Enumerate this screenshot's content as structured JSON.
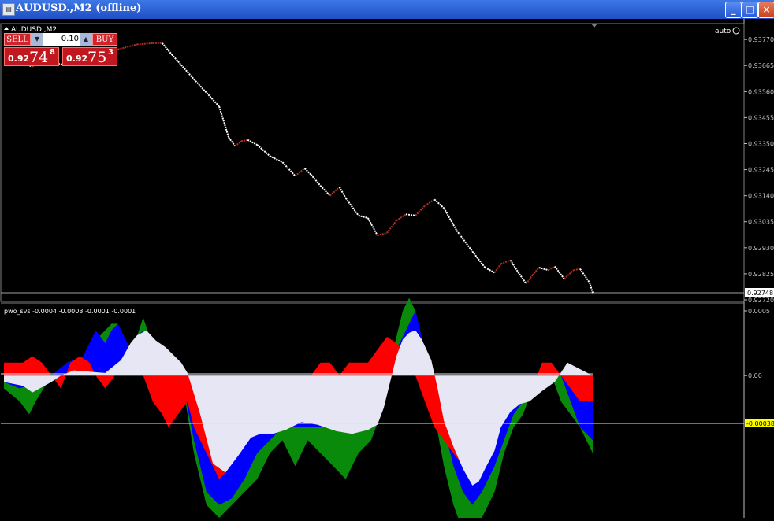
{
  "window": {
    "title": "AUDUSD.,M2 (offline)",
    "buttons": {
      "minimize": "_",
      "maximize": "□",
      "close": "×"
    }
  },
  "trade_panel": {
    "sell_label": "SELL",
    "buy_label": "BUY",
    "lot": "0.10",
    "bid": {
      "big": "0.92",
      "main": "74",
      "sup": "8"
    },
    "ask": {
      "big": "0.92",
      "main": "75",
      "sup": "3"
    }
  },
  "chart_data": [
    {
      "type": "line",
      "symbol_label": "AUDUSD.,M2",
      "auto_label": "auto",
      "y_ticks": [
        "0.93770",
        "0.93665",
        "0.93560",
        "0.93455",
        "0.93350",
        "0.93245",
        "0.93140",
        "0.93035",
        "0.92930",
        "0.92825",
        "0.92720"
      ],
      "current_price_label": "0.92748",
      "current_price": 0.92748,
      "ylim": [
        0.9272,
        0.9378
      ],
      "x_index_range": [
        0,
        186
      ],
      "series": [
        {
          "points": [
            [
              0,
              0.9367
            ],
            [
              6,
              0.93675
            ],
            [
              9,
              0.9366
            ],
            [
              11,
              0.9368
            ],
            [
              13,
              0.9367
            ],
            [
              15,
              0.9368
            ],
            [
              18,
              0.9367
            ],
            [
              22,
              0.93665
            ],
            [
              25,
              0.9368
            ],
            [
              27,
              0.93675
            ],
            [
              29,
              0.93675
            ],
            [
              31,
              0.9368
            ],
            [
              33,
              0.9371
            ],
            [
              36,
              0.9373
            ],
            [
              42,
              0.9375
            ],
            [
              47,
              0.93755
            ],
            [
              50,
              0.93755
            ],
            [
              53,
              0.9371
            ],
            [
              60,
              0.9361
            ],
            [
              68,
              0.935
            ],
            [
              71,
              0.93375
            ],
            [
              73,
              0.9334
            ],
            [
              75,
              0.9336
            ],
            [
              77,
              0.93365
            ],
            [
              80,
              0.93345
            ],
            [
              84,
              0.933
            ],
            [
              88,
              0.93275
            ],
            [
              92,
              0.9322
            ],
            [
              95,
              0.9325
            ],
            [
              97,
              0.93225
            ],
            [
              100,
              0.9318
            ],
            [
              103,
              0.9314
            ],
            [
              106,
              0.93175
            ],
            [
              108,
              0.9313
            ],
            [
              112,
              0.9306
            ],
            [
              115,
              0.9305
            ],
            [
              118,
              0.9298
            ],
            [
              121,
              0.9299
            ],
            [
              124,
              0.9304
            ],
            [
              127,
              0.93065
            ],
            [
              130,
              0.9306
            ],
            [
              133,
              0.931
            ],
            [
              136,
              0.93125
            ],
            [
              139,
              0.9309
            ],
            [
              143,
              0.93
            ],
            [
              148,
              0.92915
            ],
            [
              152,
              0.9285
            ],
            [
              155,
              0.9283
            ],
            [
              157,
              0.92865
            ],
            [
              160,
              0.9288
            ],
            [
              162,
              0.9284
            ],
            [
              165,
              0.92785
            ],
            [
              167,
              0.9282
            ],
            [
              169,
              0.9285
            ],
            [
              172,
              0.9284
            ],
            [
              174,
              0.92855
            ],
            [
              177,
              0.92805
            ],
            [
              180,
              0.9284
            ],
            [
              182,
              0.92845
            ],
            [
              185,
              0.9279
            ],
            [
              186,
              0.92748
            ]
          ]
        }
      ]
    },
    {
      "type": "area",
      "title": "pwo_svs -0.0004 -0.0003 -0.0001 -0.0001",
      "y_ticks": [
        "0.0005",
        "0.00"
      ],
      "level_label": "-0.00038",
      "level_value": -0.00038,
      "ylim": [
        -0.0011,
        0.0005
      ],
      "x_index_range": [
        0,
        186
      ],
      "series": [
        {
          "name": "white",
          "x": [
            0,
            6,
            9,
            15,
            18,
            22,
            27,
            32,
            37,
            40,
            42,
            45,
            48,
            51,
            56,
            58,
            62,
            66,
            70,
            74,
            78,
            81,
            85,
            89,
            94,
            99,
            105,
            110,
            115,
            118,
            120,
            122,
            124,
            126,
            128,
            130,
            132,
            135,
            137,
            139,
            142,
            145,
            148,
            150,
            152,
            155,
            157,
            160,
            163,
            166,
            170,
            174,
            178,
            182,
            186
          ],
          "values": [
            -5e-05,
            -8e-05,
            -0.00013,
            -5e-05,
            0,
            4e-05,
            3e-05,
            2e-05,
            0.00012,
            0.00025,
            0.00031,
            0.00035,
            0.00027,
            0.00022,
            0.0001,
            2e-05,
            -0.0003,
            -0.00068,
            -0.00075,
            -0.00062,
            -0.00048,
            -0.00045,
            -0.00045,
            -0.00042,
            -0.00036,
            -0.00038,
            -0.00043,
            -0.00045,
            -0.00042,
            -0.00038,
            -0.00025,
            -5e-05,
            0.00015,
            0.00028,
            0.00033,
            0.00035,
            0.00028,
            0.00012,
            -0.0001,
            -0.00035,
            -0.00055,
            -0.00072,
            -0.00085,
            -0.00082,
            -0.00072,
            -0.00058,
            -0.0004,
            -0.00028,
            -0.00022,
            -0.0002,
            -0.00012,
            -5e-05,
            0.0001,
            5e-05,
            0
          ]
        },
        {
          "name": "red",
          "x": [
            0,
            3,
            6,
            9,
            12,
            15,
            18,
            21,
            24,
            27,
            29,
            32,
            35,
            38,
            41,
            44,
            47,
            50,
            52,
            55,
            58,
            60,
            62,
            64,
            66,
            68,
            70,
            72,
            74,
            77,
            80,
            83,
            86,
            90,
            94,
            97,
            100,
            103,
            106,
            109,
            112,
            115,
            118,
            121,
            124,
            126,
            128,
            130,
            133,
            136,
            139,
            142,
            145,
            148,
            151,
            155,
            158,
            161,
            164,
            167,
            170,
            173,
            176,
            179,
            182,
            186
          ],
          "values": [
            0.0001,
            0.0001,
            0.0001,
            0.00015,
            0.0001,
            0,
            -0.0001,
            0.0001,
            0.00015,
            0.0001,
            0,
            -0.0001,
            0,
            0.00015,
            0.0001,
            0,
            -0.0002,
            -0.0003,
            -0.0004,
            -0.0003,
            -0.0002,
            -0.0004,
            -0.0005,
            -0.0006,
            -0.0007,
            -0.0008,
            -0.00075,
            -0.00065,
            -0.0006,
            -0.0005,
            -0.00045,
            -0.0004,
            -0.0003,
            -0.0002,
            -0.0001,
            0,
            0.0001,
            0.0001,
            0,
            0.0001,
            0.0001,
            0.0001,
            0.0002,
            0.0003,
            0.00025,
            0.0002,
            0.0001,
            0,
            -0.0002,
            -0.0004,
            -0.0005,
            -0.0006,
            -0.0007,
            -0.0006,
            -0.0005,
            -0.0004,
            -0.0003,
            -0.0002,
            -0.0001,
            -0.0001,
            0.0001,
            0.0001,
            0,
            -0.0001,
            -0.0002,
            -0.0002
          ]
        },
        {
          "name": "blue",
          "x": [
            0,
            5,
            10,
            15,
            20,
            25,
            29,
            32,
            34,
            36,
            38,
            40,
            42,
            44,
            46,
            48,
            50,
            52,
            56,
            60,
            64,
            68,
            72,
            76,
            80,
            84,
            88,
            92,
            96,
            100,
            104,
            108,
            112,
            116,
            119,
            122,
            124,
            126,
            128,
            130,
            133,
            136,
            139,
            142,
            145,
            148,
            151,
            155,
            158,
            161,
            164,
            167,
            170,
            173,
            176,
            179,
            182,
            186
          ],
          "values": [
            -5e-05,
            -0.0001,
            -5e-05,
            0,
            0.0001,
            0.00015,
            0.00035,
            0.00025,
            0.00035,
            0.0004,
            0.0003,
            0.0002,
            0.0003,
            0.00035,
            0.0003,
            0.00025,
            0.0002,
            0.0002,
            0,
            -0.0005,
            -0.0009,
            -0.001,
            -0.00095,
            -0.0008,
            -0.0006,
            -0.0005,
            -0.0004,
            -0.0004,
            -0.0004,
            -0.0004,
            -0.0004,
            -0.0004,
            -0.0004,
            -0.0004,
            -0.0003,
            0,
            0.0002,
            0.0003,
            0.0004,
            0.0005,
            0.0002,
            -0.0001,
            -0.0004,
            -0.0007,
            -0.0009,
            -0.001,
            -0.0009,
            -0.0007,
            -0.0005,
            -0.0003,
            -0.0002,
            -0.0001,
            0,
            0.0001,
            0,
            -0.0002,
            -0.0004,
            -0.0005
          ]
        },
        {
          "name": "green",
          "x": [
            0,
            5,
            8,
            10,
            15,
            20,
            25,
            30,
            34,
            36,
            38,
            40,
            42,
            44,
            46,
            48,
            52,
            56,
            60,
            64,
            68,
            72,
            76,
            80,
            84,
            88,
            92,
            96,
            100,
            104,
            108,
            112,
            116,
            119,
            122,
            124,
            126,
            128,
            130,
            133,
            136,
            139,
            142,
            145,
            148,
            151,
            155,
            158,
            161,
            164,
            167,
            170,
            173,
            176,
            179,
            182,
            186
          ],
          "values": [
            -0.0001,
            -0.0002,
            -0.0003,
            -0.0002,
            0,
            0.0001,
            0.00015,
            0.0003,
            0.0004,
            0.0004,
            0.0003,
            0.0002,
            0.0003,
            0.00045,
            0.0003,
            0.00025,
            0.0002,
            0,
            -0.0006,
            -0.001,
            -0.0011,
            -0.001,
            -0.0009,
            -0.0008,
            -0.0006,
            -0.0005,
            -0.0007,
            -0.0005,
            -0.0006,
            -0.0007,
            -0.0008,
            -0.0006,
            -0.0005,
            -0.0003,
            0.0001,
            0.0003,
            0.0005,
            0.0006,
            0.0005,
            0.0002,
            -0.0003,
            -0.0007,
            -0.001,
            -0.0012,
            -0.0013,
            -0.0011,
            -0.0009,
            -0.0006,
            -0.0004,
            -0.0003,
            -0.0001,
            0,
            0,
            -0.0002,
            -0.0003,
            -0.0004,
            -0.0006
          ]
        }
      ]
    }
  ],
  "colors": {
    "background": "#000000",
    "axis": "#c0c0c0",
    "candle_up": "#ffffff",
    "candle_down": "#b03020",
    "white_area": "#e6e6f5",
    "red_area": "#ff0000",
    "blue_area": "#0000ff",
    "green_area": "#0a8a0a",
    "level_line": "#ffff00",
    "title_bar": "#2b5fd9"
  }
}
